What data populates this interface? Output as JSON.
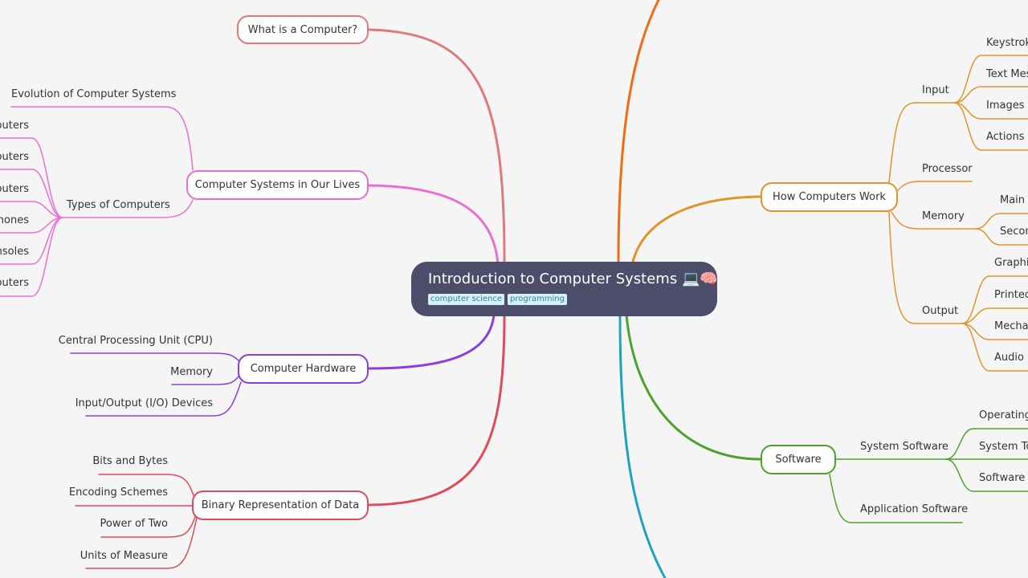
{
  "root": {
    "title": "Introduction to Computer Systems 💻🧠",
    "tags": [
      "computer science",
      "programming"
    ]
  },
  "colors": {
    "what_is": "#e07a7a",
    "lives": "#e86fcf",
    "hardware": "#8a3ee0",
    "binary": "#e04b5a",
    "top_right": "#f26a12",
    "how_work": "#e0952a",
    "software": "#4aa32a",
    "bottom_right": "#1fa3bd"
  },
  "left": {
    "what_is": {
      "label": "What is a Computer?"
    },
    "lives": {
      "label": "Computer Systems in Our Lives",
      "children": {
        "evolution": "Evolution of Computer Systems",
        "types": {
          "label": "Types of Computers",
          "children": [
            "puters",
            "puters",
            "puters",
            "hones",
            "nsoles",
            "puters"
          ]
        }
      }
    },
    "hardware": {
      "label": "Computer Hardware",
      "children": [
        "Central Processing Unit (CPU)",
        "Memory",
        "Input/Output (I/O) Devices"
      ]
    },
    "binary": {
      "label": "Binary Representation of Data",
      "children": [
        "Bits and Bytes",
        "Encoding Schemes",
        "Power of Two",
        "Units of Measure"
      ]
    }
  },
  "right": {
    "how_work": {
      "label": "How Computers Work",
      "input": {
        "label": "Input",
        "children": [
          "Keystrok",
          "Text Mes",
          "Images",
          "Actions"
        ]
      },
      "processor": {
        "label": "Processor"
      },
      "memory": {
        "label": "Memory",
        "children": [
          "Main M",
          "Secon"
        ]
      },
      "output": {
        "label": "Output",
        "children": [
          "Graphi",
          "Printed",
          "Mechan",
          "Audio C"
        ]
      }
    },
    "software": {
      "label": "Software",
      "system": {
        "label": "System Software",
        "children": [
          "Operating",
          "System To",
          "Software D"
        ]
      },
      "application": {
        "label": "Application Software"
      }
    }
  }
}
